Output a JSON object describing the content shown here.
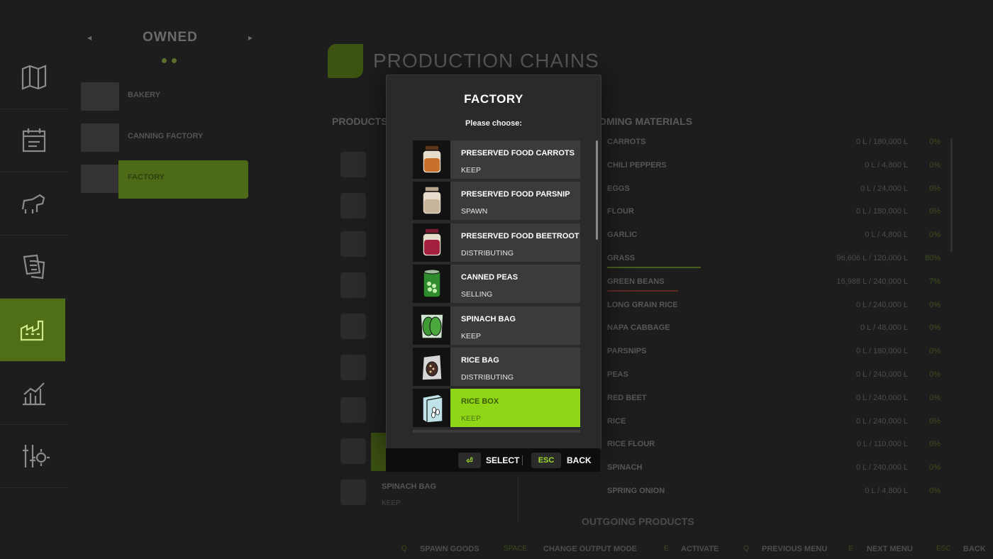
{
  "page": {
    "title": "PRODUCTION CHAINS"
  },
  "owned": {
    "header": "OWNED",
    "items": [
      {
        "label": "BAKERY"
      },
      {
        "label": "CANNING FACTORY"
      },
      {
        "label": "FACTORY"
      }
    ]
  },
  "columns": {
    "products": "PRODUCTS",
    "incoming": "INCOMING MATERIALS",
    "outgoing": "OUTGOING PRODUCTS"
  },
  "background_products": {
    "last_name": "SPINACH BAG",
    "last_status": "KEEP"
  },
  "incoming_materials": [
    {
      "name": "CARROTS",
      "qty": "0 L / 180,000 L",
      "pct": "0%"
    },
    {
      "name": "CHILI PEPPERS",
      "qty": "0 L / 4,800 L",
      "pct": "0%"
    },
    {
      "name": "EGGS",
      "qty": "0 L / 24,000 L",
      "pct": "0%"
    },
    {
      "name": "FLOUR",
      "qty": "0 L / 180,000 L",
      "pct": "0%"
    },
    {
      "name": "GARLIC",
      "qty": "0 L / 4,800 L",
      "pct": "0%"
    },
    {
      "name": "GRASS",
      "qty": "96,606 L / 120,000 L",
      "pct": "80%"
    },
    {
      "name": "GREEN BEANS",
      "qty": "16,988 L / 240,000 L",
      "pct": "7%"
    },
    {
      "name": "LONG GRAIN RICE",
      "qty": "0 L / 240,000 L",
      "pct": "0%"
    },
    {
      "name": "NAPA CABBAGE",
      "qty": "0 L / 48,000 L",
      "pct": "0%"
    },
    {
      "name": "PARSNIPS",
      "qty": "0 L / 180,000 L",
      "pct": "0%"
    },
    {
      "name": "PEAS",
      "qty": "0 L / 240,000 L",
      "pct": "0%"
    },
    {
      "name": "RED BEET",
      "qty": "0 L / 240,000 L",
      "pct": "0%"
    },
    {
      "name": "RICE",
      "qty": "0 L / 240,000 L",
      "pct": "0%"
    },
    {
      "name": "RICE FLOUR",
      "qty": "0 L / 110,000 L",
      "pct": "0%"
    },
    {
      "name": "SPINACH",
      "qty": "0 L / 240,000 L",
      "pct": "0%"
    },
    {
      "name": "SPRING ONION",
      "qty": "0 L / 4,800 L",
      "pct": "0%"
    }
  ],
  "modal": {
    "title": "FACTORY",
    "subtitle": "Please choose:",
    "options": [
      {
        "name": "PRESERVED FOOD CARROTS",
        "status": "KEEP",
        "icon": "jar-carrots-icon",
        "color": "#c8702c"
      },
      {
        "name": "PRESERVED FOOD PARSNIP",
        "status": "SPAWN",
        "icon": "jar-parsnip-icon",
        "color": "#c8b49a"
      },
      {
        "name": "PRESERVED FOOD BEETROOT",
        "status": "DISTRIBUTING",
        "icon": "jar-beetroot-icon",
        "color": "#a3213f"
      },
      {
        "name": "CANNED PEAS",
        "status": "SELLING",
        "icon": "canned-peas-icon",
        "color": "#2e8b2e"
      },
      {
        "name": "SPINACH BAG",
        "status": "KEEP",
        "icon": "spinach-bag-icon",
        "color": "#3f9a34"
      },
      {
        "name": "RICE BAG",
        "status": "DISTRIBUTING",
        "icon": "rice-bag-icon",
        "color": "#c9c9c9"
      },
      {
        "name": "RICE BOX",
        "status": "KEEP",
        "icon": "rice-box-icon",
        "color": "#bfe3e8"
      }
    ],
    "footer": {
      "select_key": "⏎",
      "select_label": "SELECT",
      "back_key": "ESC",
      "back_label": "BACK"
    }
  },
  "hints": [
    {
      "key": "Q",
      "label": "SPAWN GOODS"
    },
    {
      "key": "SPACE",
      "label": "CHANGE OUTPUT MODE"
    },
    {
      "key": "E",
      "label": "ACTIVATE"
    },
    {
      "key": "Q",
      "label": "PREVIOUS MENU"
    },
    {
      "key": "E",
      "label": "NEXT MENU"
    },
    {
      "key": "ESC",
      "label": "BACK"
    }
  ],
  "colors": {
    "accent": "#8fd616",
    "active_nav": "#4f6e15"
  }
}
